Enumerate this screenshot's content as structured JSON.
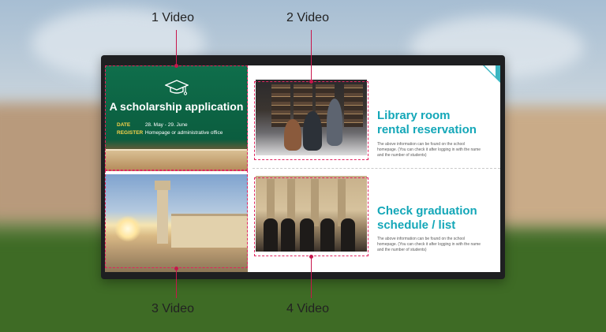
{
  "labels": [
    "1 Video",
    "2 Video",
    "3 Video",
    "4 Video"
  ],
  "scholarship": {
    "title": "A scholarship application",
    "date_key": "DATE",
    "date_value": "28. May - 29. June",
    "register_key": "REGISTER",
    "register_value": "Homepage or administrative office"
  },
  "library": {
    "title_line1": "Library room",
    "title_line2": "rental reservation",
    "desc": "The above information can be found on the school homepage. (You can check it after logging in with the name and the number of students)"
  },
  "graduation": {
    "title_line1": "Check graduation",
    "title_line2": "schedule / list",
    "desc": "The above information can be found on the school homepage. (You can check it after logging in with the name and the number of students)"
  },
  "colors": {
    "accent": "#14a7b8",
    "callout": "#e0245e",
    "panel_green": "#0f6e4b"
  }
}
